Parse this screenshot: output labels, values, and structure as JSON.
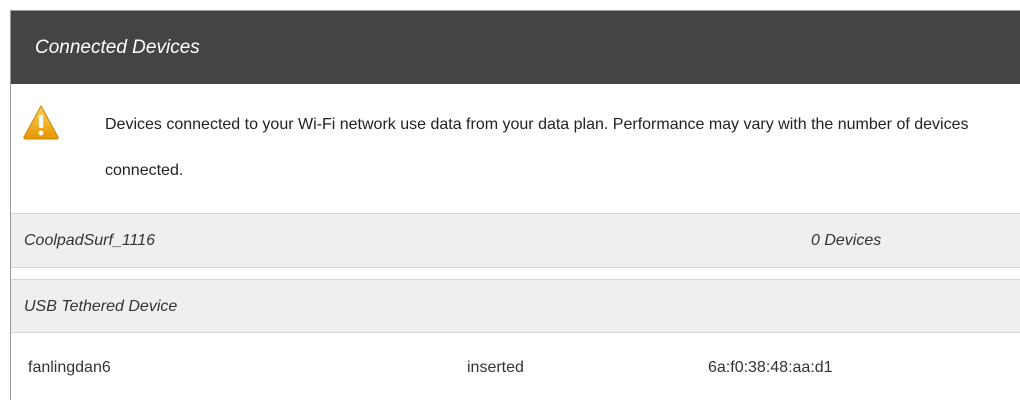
{
  "header": {
    "title": "Connected Devices"
  },
  "notice": {
    "icon": "warning-icon",
    "text": "Devices connected to your Wi-Fi network use data from your data plan. Performance may vary with the number of devices connected."
  },
  "groups": [
    {
      "name": "CoolpadSurf_1116",
      "count": "0 Devices"
    },
    {
      "name": "USB Tethered Device",
      "devices": [
        {
          "name": "fanlingdan6",
          "status": "inserted",
          "mac": "6a:f0:38:48:aa:d1"
        }
      ]
    }
  ],
  "colors": {
    "header_bg": "#444444",
    "row_bg": "#efefef",
    "warning": "#f0a400"
  }
}
